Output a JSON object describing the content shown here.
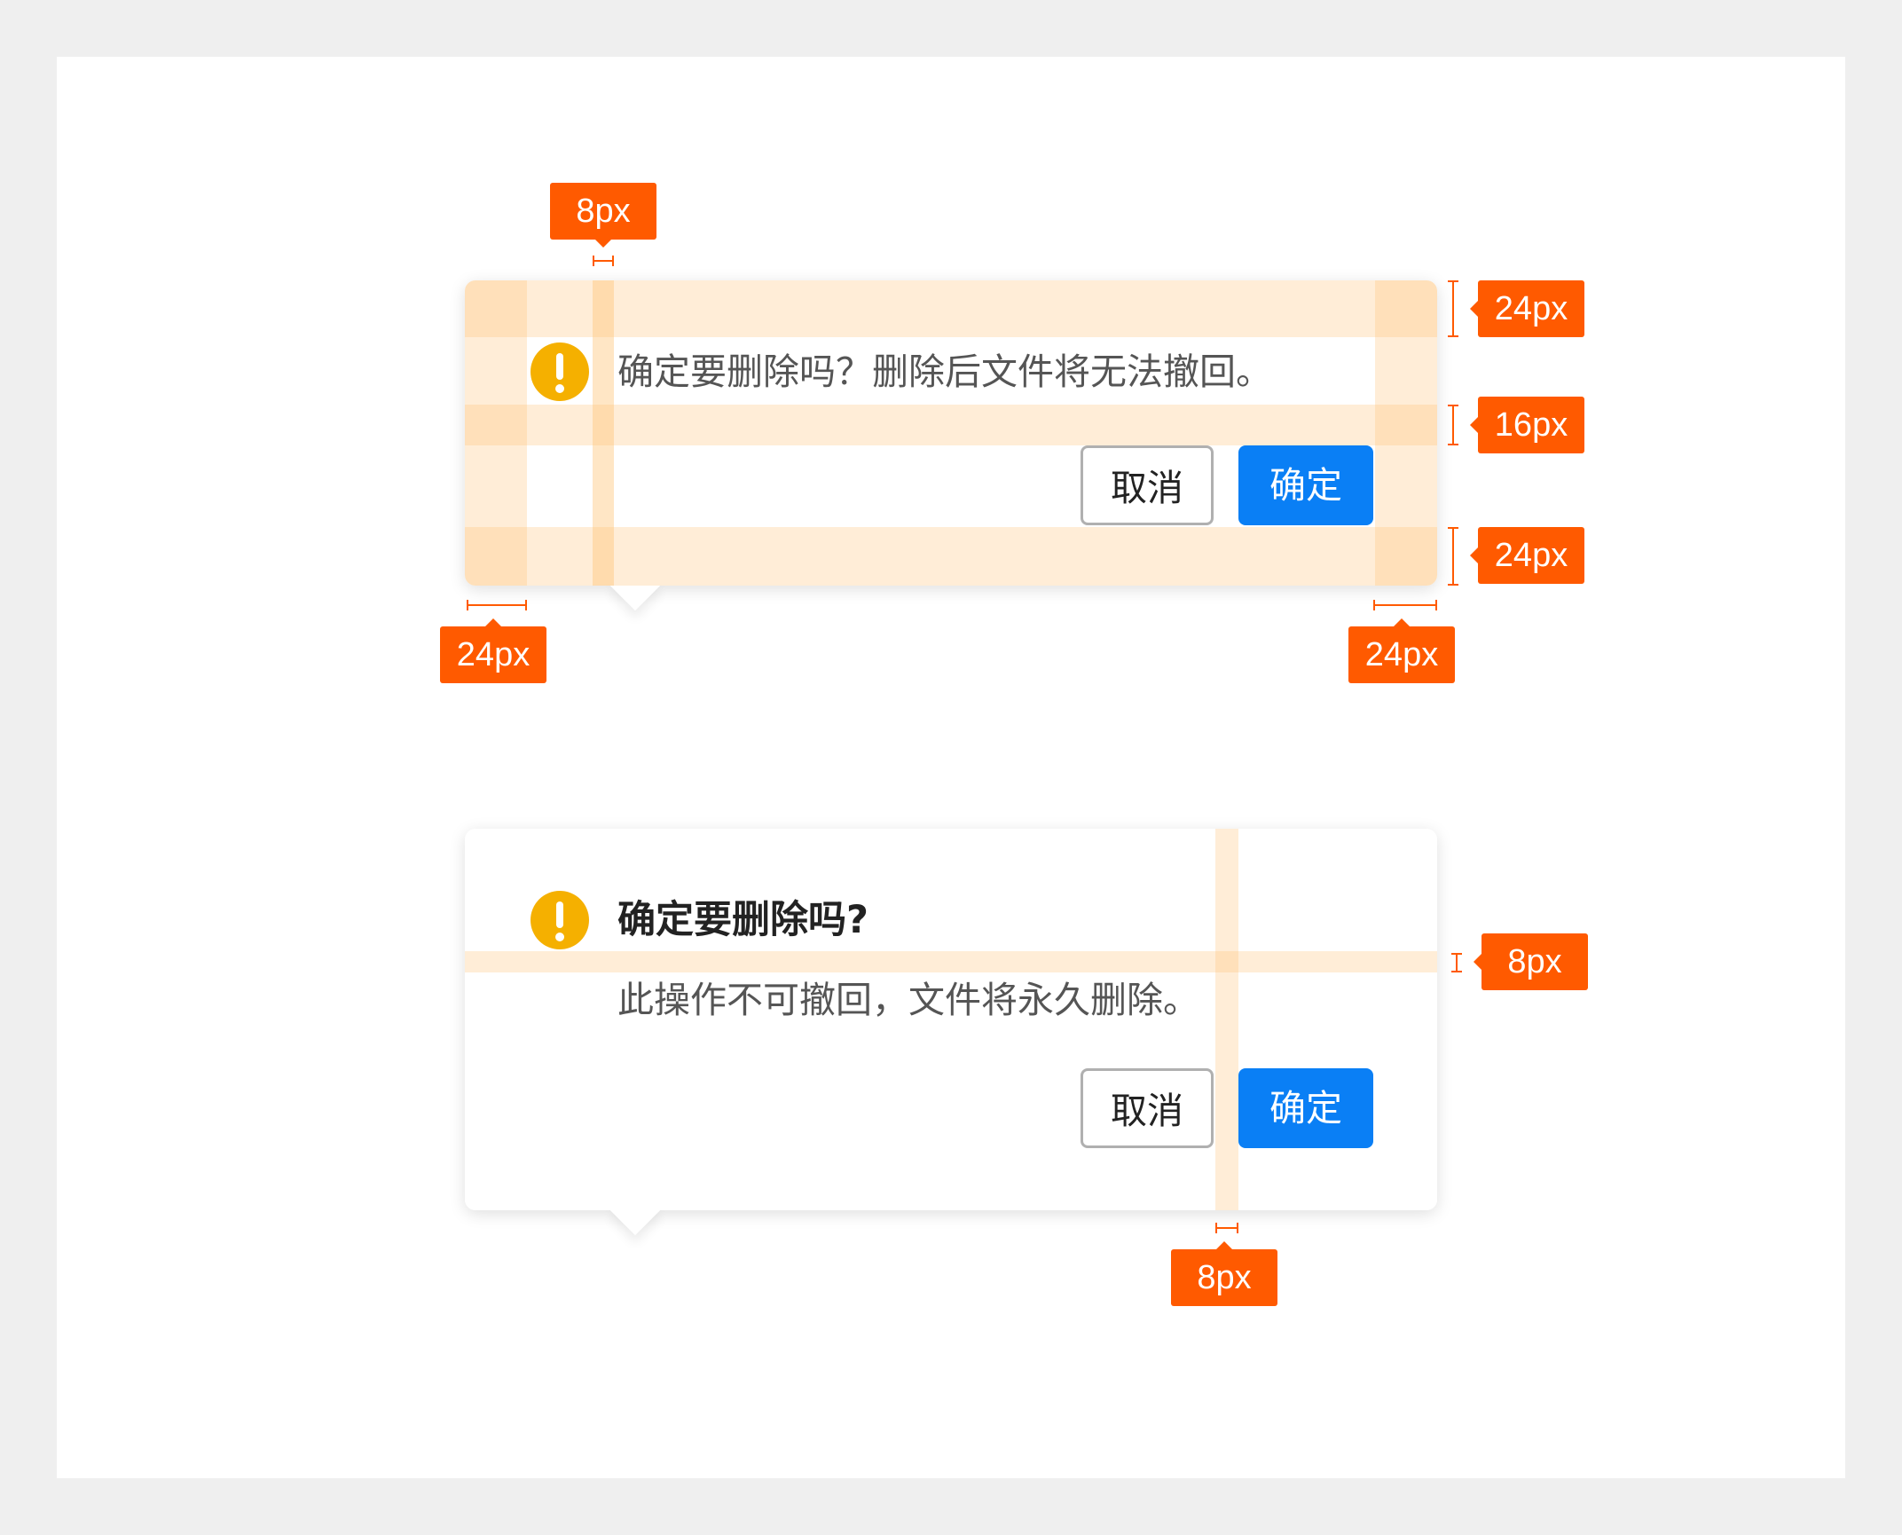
{
  "popover_a": {
    "message": "确定要删除吗？删除后文件将无法撤回。",
    "cancel_label": "取消",
    "confirm_label": "确定"
  },
  "popover_b": {
    "title": "确定要删除吗?",
    "description": "此操作不可撤回，文件将永久删除。",
    "cancel_label": "取消",
    "confirm_label": "确定"
  },
  "annotations": {
    "icon_gap": "8px",
    "top_padding": "24px",
    "content_gap": "16px",
    "bottom_padding": "24px",
    "left_padding": "24px",
    "right_padding": "24px",
    "title_gap": "8px",
    "button_gap": "8px"
  },
  "colors": {
    "accent": "#0a7ff5",
    "warning": "#f5b000",
    "annotation": "#ff5a00",
    "spacing_highlight": "#ffc06e"
  }
}
